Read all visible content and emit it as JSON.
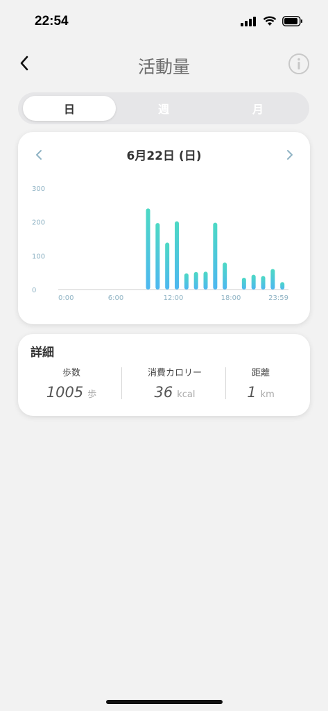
{
  "status": {
    "time": "22:54"
  },
  "nav": {
    "title": "活動量"
  },
  "tabs": [
    {
      "label": "日"
    },
    {
      "label": "週"
    },
    {
      "label": "月"
    }
  ],
  "chart_header": {
    "date": "6月22日 (日)"
  },
  "chart_data": {
    "type": "bar",
    "y_ticks": [
      "300",
      "200",
      "100",
      "0"
    ],
    "x_ticks": [
      "0:00",
      "6:00",
      "12:00",
      "18:00",
      "23:59"
    ],
    "x": [
      "9:00",
      "9:30",
      "10:00",
      "10:30",
      "11:00",
      "11:30",
      "12:00",
      "12:30",
      "13:00",
      "13:30",
      "14:00",
      "14:30",
      "15:00",
      "15:30",
      "16:00",
      "16:30",
      "17:00",
      "17:30",
      "18:00",
      "18:30",
      "19:00",
      "19:30",
      "20:00",
      "20:30",
      "21:00",
      "21:30",
      "22:00",
      "22:30",
      "23:00",
      "23:30"
    ],
    "values": [
      240,
      197,
      139,
      202,
      48,
      52,
      53,
      198,
      80,
      0,
      35,
      44,
      40,
      61,
      22
    ],
    "bar_hours": [
      9.0,
      10.0,
      11.0,
      12.0,
      13.0,
      14.0,
      15.0,
      16.0,
      17.0,
      18.0,
      19.0,
      20.0,
      21.0,
      22.0,
      23.0
    ],
    "ylim": [
      0,
      300
    ],
    "colors": {
      "bar_top": "#4dd9c4",
      "bar_bottom": "#4eb7f0",
      "axis": "#8fb3c4"
    }
  },
  "details": {
    "title": "詳細",
    "steps": {
      "label": "歩数",
      "value": "1005",
      "unit": "歩"
    },
    "calories": {
      "label": "消費カロリー",
      "value": "36",
      "unit": "kcal"
    },
    "distance": {
      "label": "距離",
      "value": "1",
      "unit": "km"
    }
  }
}
